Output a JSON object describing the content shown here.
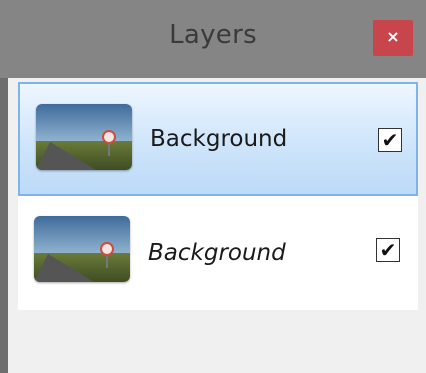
{
  "panel": {
    "title": "Layers",
    "close_label": "×"
  },
  "layers": [
    {
      "name": "Background",
      "visible": true,
      "selected": true,
      "italic": false,
      "check": "✔"
    },
    {
      "name": "Background",
      "visible": true,
      "selected": false,
      "italic": true,
      "check": "✔"
    }
  ],
  "colors": {
    "titlebar": "#858585",
    "close_button": "#c8454b",
    "selection_border": "#7eb4ea"
  }
}
